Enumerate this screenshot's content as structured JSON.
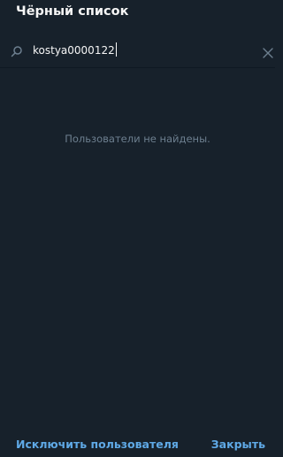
{
  "dialog": {
    "title": "Чёрный список",
    "empty_message": "Пользователи не найдены."
  },
  "search": {
    "value": "kostya0000122",
    "icon": "search-icon",
    "clear_icon": "close-icon"
  },
  "footer": {
    "unblock_label": "Исключить пользователя",
    "close_label": "Закрыть"
  },
  "colors": {
    "background": "#17212b",
    "accent": "#5fa9e6",
    "text": "#f5f5f5",
    "muted": "#6d7f8f"
  }
}
